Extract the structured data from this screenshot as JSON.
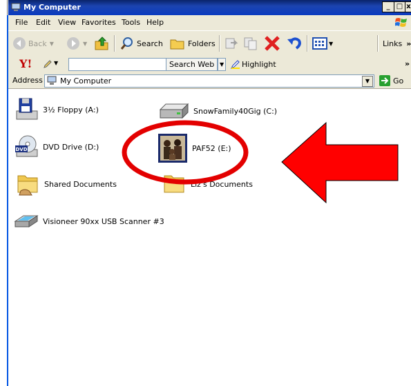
{
  "window": {
    "title": "My Computer",
    "controls": {
      "minimize": "_",
      "maximize": "□",
      "close": "x"
    }
  },
  "menu": {
    "items": [
      "File",
      "Edit",
      "View",
      "Favorites",
      "Tools",
      "Help"
    ]
  },
  "toolbar": {
    "back_label": "Back",
    "search_label": "Search",
    "folders_label": "Folders",
    "links_label": "Links",
    "chevron": "»"
  },
  "yahoo_bar": {
    "logo": "Y!",
    "search_input_value": "",
    "search_web_label": "Search Web",
    "highlight_label": "Highlight",
    "chevron": "»"
  },
  "address_bar": {
    "label": "Address",
    "value": "My Computer",
    "go_label": "Go"
  },
  "content": {
    "items": [
      {
        "label": "3½ Floppy (A:)",
        "icon": "floppy-drive-icon"
      },
      {
        "label": "SnowFamily40Gig (C:)",
        "icon": "hard-drive-icon"
      },
      {
        "label": "DVD Drive (D:)",
        "icon": "dvd-drive-icon"
      },
      {
        "label": "PAF52 (E:)",
        "icon": "family-photo-drive-icon"
      },
      {
        "label": "Shared Documents",
        "icon": "shared-folder-icon"
      },
      {
        "label": "Liz's Documents",
        "icon": "folder-icon"
      },
      {
        "label": "Visioneer 90xx USB Scanner #3",
        "icon": "scanner-icon"
      }
    ]
  },
  "annotations": {
    "highlight_circle_color": "#e30000",
    "arrow_color": "#ff0000"
  }
}
